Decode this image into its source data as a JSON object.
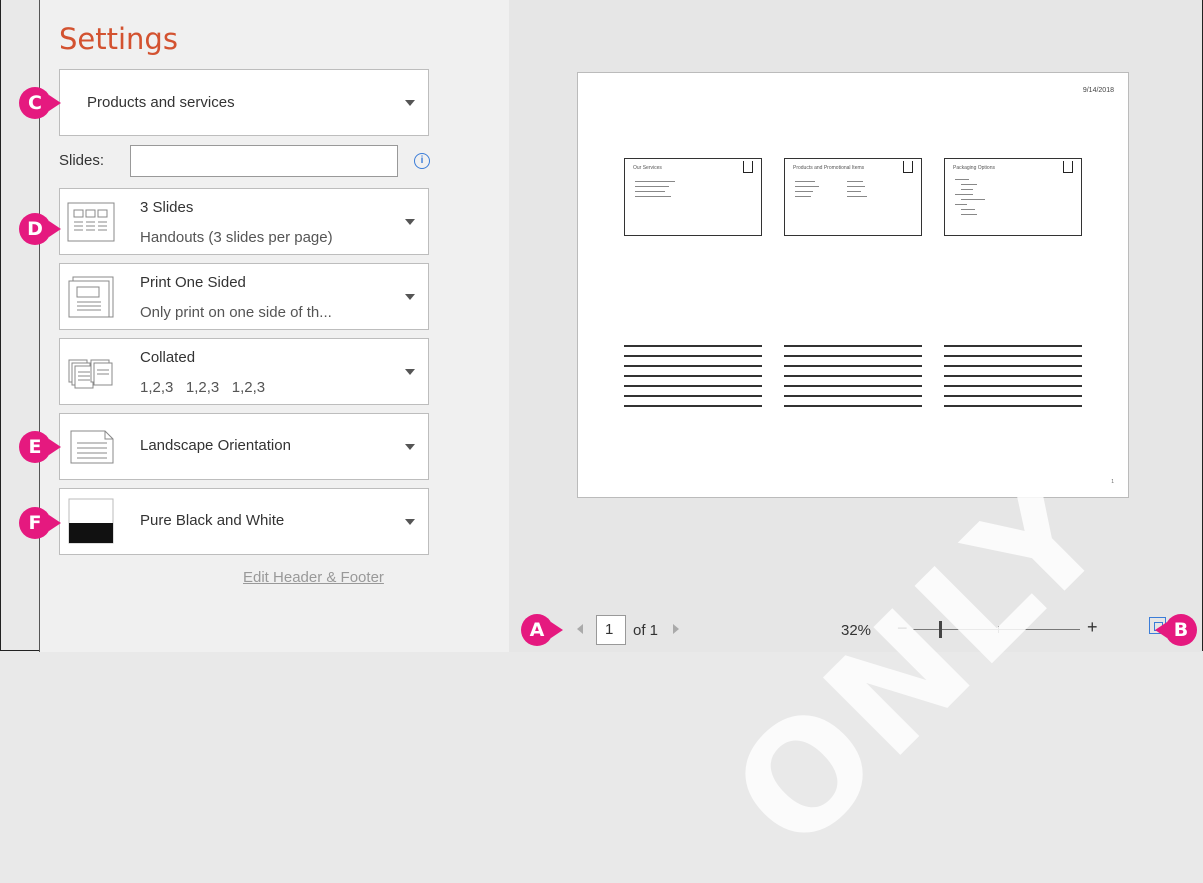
{
  "settings": {
    "title": "Settings",
    "print_what": "Products and services",
    "slides_label": "Slides:",
    "slides_value": "",
    "info_icon": "i",
    "layout": {
      "line1": "3 Slides",
      "line2": "Handouts (3 slides per page)"
    },
    "sides": {
      "line1": "Print One Sided",
      "line2": "Only print on one side of th..."
    },
    "collation": {
      "line1": "Collated",
      "line2": "1,2,3   1,2,3   1,2,3"
    },
    "orientation": {
      "line1": "Landscape Orientation"
    },
    "color": {
      "line1": "Pure Black and White"
    },
    "edit_link": "Edit Header & Footer"
  },
  "preview": {
    "date": "9/14/2018",
    "thumbs": [
      {
        "title": "Our Services"
      },
      {
        "title": "Products and Promotional Items"
      },
      {
        "title": "Packaging Options"
      }
    ],
    "page_num": "1"
  },
  "nav": {
    "page_value": "1",
    "of_label": "of 1",
    "zoom_label": "32%",
    "minus": "−",
    "plus": "+"
  },
  "badges": {
    "a": "A",
    "b": "B",
    "c": "C",
    "d": "D",
    "e": "E",
    "f": "F"
  },
  "watermark": "ONLY",
  "colors": {
    "accent": "#d35230",
    "badge": "#e5197f",
    "link_blue": "#3b7dd8"
  }
}
